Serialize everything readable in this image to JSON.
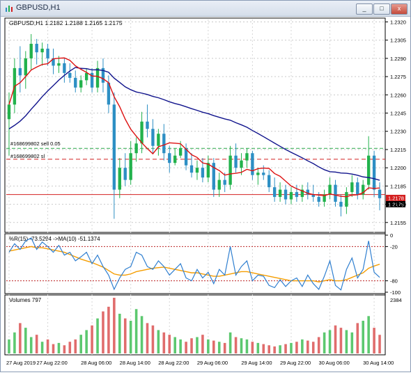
{
  "window": {
    "title": "GBPUSD,H1",
    "buttons": [
      "_",
      "□",
      "x"
    ]
  },
  "main_panel": {
    "header": "GBPUSD,H1  1.2182 1.2188 1.2165 1.2175",
    "order_labels": [
      "#168699802 sell 0.05",
      "#168699802 sl"
    ],
    "price_axis": [
      "1.2320",
      "1.2305",
      "1.2290",
      "1.2275",
      "1.2260",
      "1.2245",
      "1.2230",
      "1.2215",
      "1.2200",
      "1.2185",
      "1.2170",
      "1.2155"
    ],
    "price_tags": [
      "1.2178",
      "1.2175"
    ]
  },
  "wr_panel": {
    "header": "%R(15) -73.5294 ->MA(10) -51.1374",
    "axis": [
      "0",
      "-20",
      "-80",
      "-100"
    ]
  },
  "vol_panel": {
    "header": "Volumes 797",
    "axis": [
      "2384"
    ]
  },
  "time_axis": [
    "27 Aug 2019",
    "27 Aug 22:00",
    "28 Aug 06:00",
    "28 Aug 14:00",
    "28 Aug 22:00",
    "29 Aug 06:00",
    "29 Aug 14:00",
    "29 Aug 22:00",
    "30 Aug 06:00",
    "30 Aug 14:00"
  ],
  "colors": {
    "bull": "#22b24c",
    "bear": "#2d8fc4",
    "ma_fast": "#dd1111",
    "ma_slow": "#10138c",
    "wr_line": "#2f7fd0",
    "wr_ma": "#f59d00",
    "level_red": "#d42020",
    "level_green": "#2aa84a"
  },
  "chart_data": [
    {
      "type": "candlestick",
      "title": "GBPUSD,H1",
      "ylim": [
        1.2148,
        1.2322
      ],
      "candles_ohlc": [
        [
          1.224,
          1.2262,
          1.221,
          1.2252
        ],
        [
          1.2252,
          1.229,
          1.2245,
          1.2282
        ],
        [
          1.2282,
          1.23,
          1.2262,
          1.2276
        ],
        [
          1.2276,
          1.2296,
          1.2265,
          1.229
        ],
        [
          1.229,
          1.231,
          1.228,
          1.2302
        ],
        [
          1.2302,
          1.2306,
          1.2285,
          1.2295
        ],
        [
          1.2295,
          1.2303,
          1.2284,
          1.2298
        ],
        [
          1.2298,
          1.2302,
          1.2284,
          1.229
        ],
        [
          1.229,
          1.2298,
          1.2277,
          1.2284
        ],
        [
          1.2284,
          1.2292,
          1.2278,
          1.2286
        ],
        [
          1.2286,
          1.229,
          1.227,
          1.2278
        ],
        [
          1.2278,
          1.2286,
          1.227,
          1.2274
        ],
        [
          1.2274,
          1.228,
          1.2262,
          1.2266
        ],
        [
          1.2266,
          1.2276,
          1.2262,
          1.2272
        ],
        [
          1.2272,
          1.2282,
          1.2268,
          1.2278
        ],
        [
          1.2278,
          1.2282,
          1.2262,
          1.2266
        ],
        [
          1.2266,
          1.2288,
          1.2262,
          1.2282
        ],
        [
          1.2282,
          1.229,
          1.2262,
          1.227
        ],
        [
          1.227,
          1.2276,
          1.2245,
          1.2252
        ],
        [
          1.2252,
          1.2262,
          1.2158,
          1.2182
        ],
        [
          1.2182,
          1.2208,
          1.2175,
          1.22
        ],
        [
          1.22,
          1.2212,
          1.2185,
          1.219
        ],
        [
          1.219,
          1.2222,
          1.2186,
          1.2212
        ],
        [
          1.2212,
          1.2225,
          1.2205,
          1.222
        ],
        [
          1.222,
          1.2246,
          1.2212,
          1.2238
        ],
        [
          1.2238,
          1.2252,
          1.2225,
          1.2232
        ],
        [
          1.2232,
          1.224,
          1.2212,
          1.2218
        ],
        [
          1.2218,
          1.2232,
          1.221,
          1.2228
        ],
        [
          1.2228,
          1.2236,
          1.2206,
          1.2212
        ],
        [
          1.2212,
          1.2218,
          1.2196,
          1.2204
        ],
        [
          1.2204,
          1.2216,
          1.2202,
          1.221
        ],
        [
          1.221,
          1.2222,
          1.2208,
          1.2216
        ],
        [
          1.2216,
          1.222,
          1.2198,
          1.2202
        ],
        [
          1.2202,
          1.2212,
          1.2192,
          1.2196
        ],
        [
          1.2196,
          1.2206,
          1.219,
          1.22
        ],
        [
          1.22,
          1.2208,
          1.2188,
          1.2192
        ],
        [
          1.2192,
          1.221,
          1.2188,
          1.2204
        ],
        [
          1.2204,
          1.2208,
          1.2176,
          1.2182
        ],
        [
          1.2182,
          1.2196,
          1.2176,
          1.219
        ],
        [
          1.219,
          1.2196,
          1.218,
          1.2186
        ],
        [
          1.2186,
          1.2218,
          1.2182,
          1.221
        ],
        [
          1.221,
          1.222,
          1.2196,
          1.22
        ],
        [
          1.22,
          1.2212,
          1.2194,
          1.2206
        ],
        [
          1.2206,
          1.2216,
          1.22,
          1.2212
        ],
        [
          1.2212,
          1.2214,
          1.219,
          1.2194
        ],
        [
          1.2194,
          1.22,
          1.2186,
          1.2196
        ],
        [
          1.2196,
          1.2202,
          1.219,
          1.2194
        ],
        [
          1.2194,
          1.2198,
          1.218,
          1.2184
        ],
        [
          1.2184,
          1.2192,
          1.2172,
          1.2176
        ],
        [
          1.2176,
          1.2188,
          1.2172,
          1.2182
        ],
        [
          1.2182,
          1.2186,
          1.217,
          1.2174
        ],
        [
          1.2174,
          1.2184,
          1.217,
          1.218
        ],
        [
          1.218,
          1.2186,
          1.2172,
          1.2176
        ],
        [
          1.2176,
          1.2186,
          1.2172,
          1.2182
        ],
        [
          1.2182,
          1.2188,
          1.2174,
          1.2178
        ],
        [
          1.2178,
          1.2186,
          1.2172,
          1.2176
        ],
        [
          1.2176,
          1.218,
          1.2168,
          1.2172
        ],
        [
          1.2172,
          1.2182,
          1.2168,
          1.2178
        ],
        [
          1.2178,
          1.2192,
          1.2174,
          1.2186
        ],
        [
          1.2186,
          1.219,
          1.2168,
          1.2172
        ],
        [
          1.2172,
          1.2178,
          1.216,
          1.2168
        ],
        [
          1.2168,
          1.2184,
          1.2162,
          1.218
        ],
        [
          1.218,
          1.2194,
          1.2176,
          1.2188
        ],
        [
          1.2188,
          1.2192,
          1.2174,
          1.2178
        ],
        [
          1.2178,
          1.219,
          1.2174,
          1.2186
        ],
        [
          1.2186,
          1.2226,
          1.2182,
          1.221
        ],
        [
          1.221,
          1.2214,
          1.2176,
          1.2182
        ],
        [
          1.2182,
          1.2188,
          1.2165,
          1.2175
        ]
      ],
      "levels": {
        "sell": 1.2216,
        "stop_loss": 1.2207,
        "current": 1.2178
      }
    },
    {
      "type": "line",
      "title": "%R(15) -73.5294 ->MA(10) -51.1374",
      "ylim": [
        -100,
        0
      ],
      "levels": [
        -20,
        -80
      ],
      "series": [
        {
          "name": "%R(15)",
          "values": [
            -30,
            -15,
            -25,
            -10,
            -5,
            -25,
            -12,
            -20,
            -30,
            -18,
            -35,
            -30,
            -45,
            -38,
            -30,
            -50,
            -35,
            -55,
            -70,
            -95,
            -75,
            -60,
            -55,
            -30,
            -35,
            -55,
            -60,
            -45,
            -55,
            -70,
            -60,
            -50,
            -75,
            -80,
            -60,
            -75,
            -65,
            -85,
            -60,
            -70,
            -20,
            -70,
            -55,
            -45,
            -80,
            -70,
            -72,
            -88,
            -92,
            -78,
            -90,
            -80,
            -75,
            -90,
            -70,
            -85,
            -95,
            -72,
            -45,
            -88,
            -96,
            -60,
            -40,
            -75,
            -60,
            -10,
            -65,
            -74
          ]
        },
        {
          "name": "MA(10)",
          "values": [
            -28,
            -26,
            -24,
            -22,
            -20,
            -22,
            -22,
            -24,
            -26,
            -28,
            -30,
            -34,
            -38,
            -42,
            -45,
            -48,
            -52,
            -56,
            -62,
            -68,
            -70,
            -70,
            -68,
            -64,
            -62,
            -60,
            -58,
            -57,
            -56,
            -58,
            -60,
            -62,
            -64,
            -66,
            -66,
            -68,
            -70,
            -72,
            -72,
            -70,
            -68,
            -66,
            -64,
            -64,
            -66,
            -68,
            -70,
            -72,
            -74,
            -76,
            -78,
            -80,
            -80,
            -80,
            -80,
            -80,
            -82,
            -80,
            -78,
            -80,
            -80,
            -78,
            -74,
            -70,
            -66,
            -58,
            -54,
            -51
          ]
        }
      ]
    },
    {
      "type": "bar",
      "title": "Volumes 797",
      "ylim": [
        0,
        2384
      ],
      "values": [
        600,
        900,
        1300,
        1100,
        700,
        800,
        500,
        600,
        400,
        450,
        350,
        500,
        600,
        800,
        1000,
        1200,
        1500,
        1800,
        2000,
        2384,
        1700,
        1500,
        1400,
        1900,
        1600,
        1300,
        1200,
        1000,
        900,
        800,
        700,
        600,
        500,
        650,
        700,
        800,
        600,
        550,
        500,
        450,
        900,
        700,
        650,
        600,
        500,
        450,
        400,
        350,
        300,
        350,
        400,
        450,
        500,
        600,
        550,
        500,
        700,
        900,
        1000,
        1200,
        1100,
        1000,
        900,
        1300,
        1400,
        1600,
        1100,
        797
      ]
    }
  ]
}
